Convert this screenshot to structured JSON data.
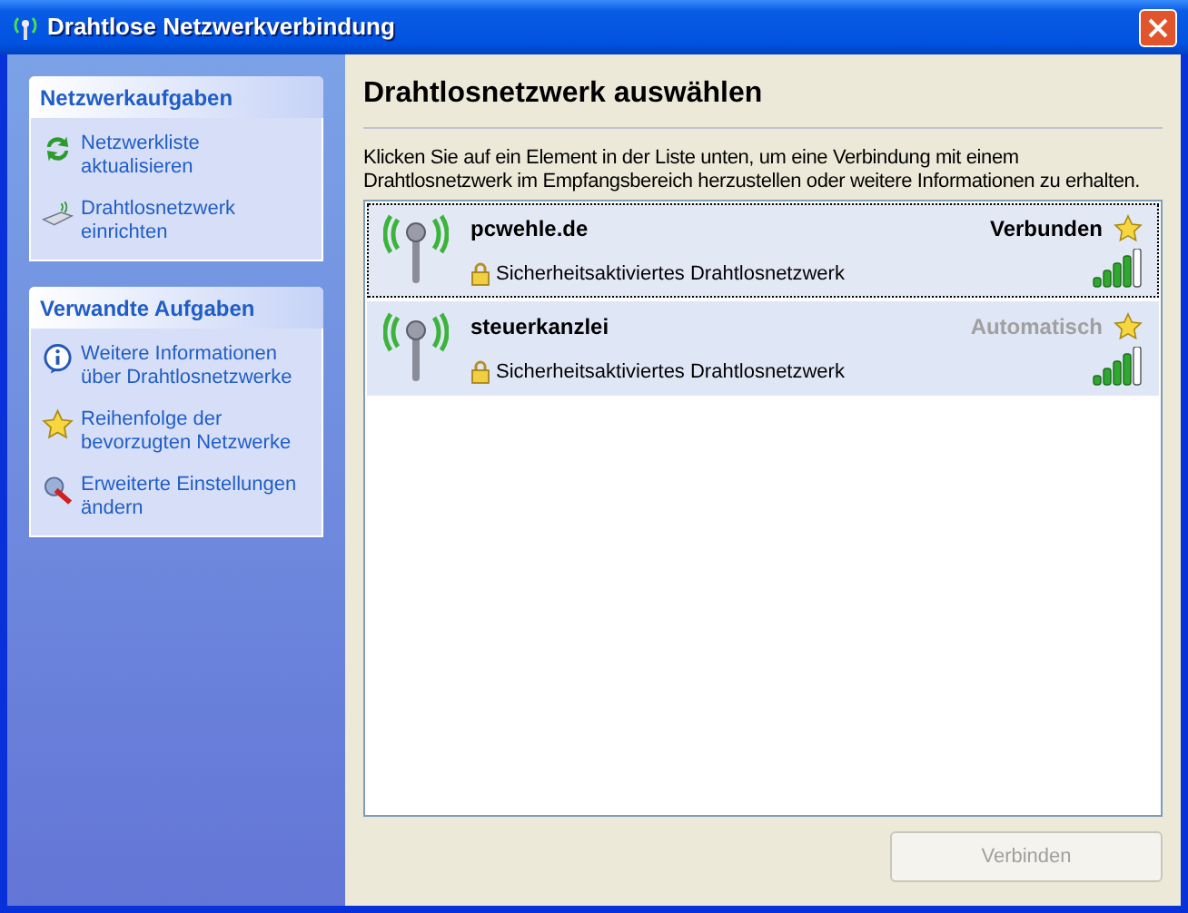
{
  "window": {
    "title": "Drahtlose Netzwerkverbindung"
  },
  "sidebar": [
    {
      "title": "Netzwerkaufgaben",
      "items": [
        {
          "label": "Netzwerkliste aktualisieren"
        },
        {
          "label": "Drahtlosnetzwerk einrichten"
        }
      ]
    },
    {
      "title": "Verwandte Aufgaben",
      "items": [
        {
          "label": "Weitere Informationen über Drahtlosnetzwerke"
        },
        {
          "label": "Reihenfolge der bevorzugten Netzwerke"
        },
        {
          "label": "Erweiterte Einstellungen ändern"
        }
      ]
    }
  ],
  "heading": "Drahtlosnetzwerk auswählen",
  "description": "Klicken Sie auf ein Element in der Liste unten, um eine Verbindung mit einem Drahtlosnetzwerk im Empfangsbereich herzustellen oder weitere Informationen zu erhalten.",
  "networks": [
    {
      "name": "pcwehle.de",
      "status": "Verbunden",
      "connected": true,
      "security": "Sicherheitsaktiviertes Drahtlosnetzwerk",
      "selected": true
    },
    {
      "name": "steuerkanzlei",
      "status": "Automatisch",
      "connected": false,
      "security": "Sicherheitsaktiviertes Drahtlosnetzwerk",
      "selected": false
    }
  ],
  "connect_button": {
    "label": "Verbinden",
    "disabled": true
  }
}
